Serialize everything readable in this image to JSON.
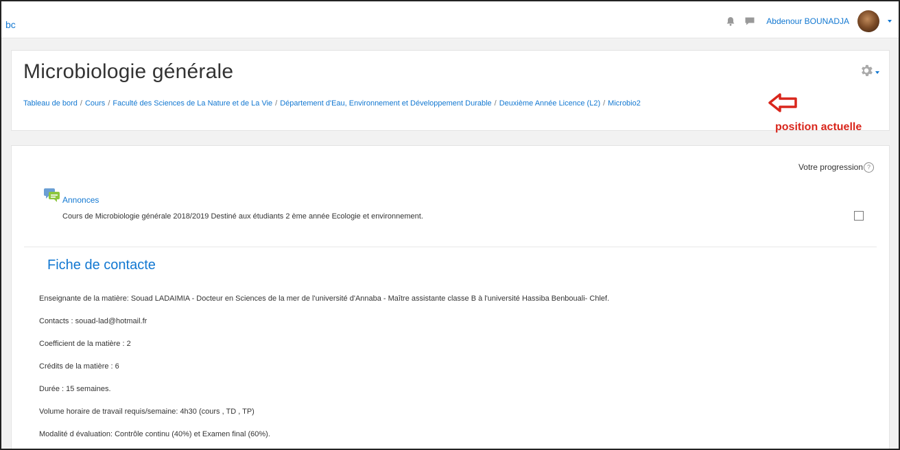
{
  "navbar": {
    "brand": "bc",
    "username": "Abdenour BOUNADJA"
  },
  "header": {
    "title": "Microbiologie générale",
    "breadcrumb": [
      "Tableau de bord",
      "Cours",
      "Faculté des Sciences de La Nature et de La Vie",
      "Département d'Eau, Environnement et Développement Durable",
      "Deuxième Année Licence (L2)",
      "Microbio2"
    ],
    "annotation": "position actuelle"
  },
  "content": {
    "progress_label": "Votre progression",
    "help_symbol": "?",
    "forum": {
      "link": "Annonces",
      "description": "Cours de Microbiologie générale 2018/2019 Destiné aux étudiants 2 ème année Ecologie et environnement."
    },
    "section_title": "Fiche de contacte",
    "lines": [
      "Enseignante de la matière: Souad LADAIMIA - Docteur en Sciences de la mer de l'université d'Annaba - Maître assistante classe B à l'université Hassiba Benbouali- Chlef.",
      " Contacts : souad-lad@hotmail.fr",
      " Coefficient de la matière  : 2",
      "Crédits de la matière : 6",
      "Durée : 15 semaines.",
      "Volume horaire de travail requis/semaine: 4h30  (cours , TD , TP)",
      "Modalité d évaluation: Contrôle continu (40%)  et Examen final (60%)."
    ]
  },
  "colors": {
    "link": "#1177d1",
    "annotation": "#d9261c"
  },
  "icons": [
    "bell-icon",
    "chat-icon",
    "gear-icon",
    "forum-icon",
    "help-icon",
    "arrow-left-icon"
  ]
}
